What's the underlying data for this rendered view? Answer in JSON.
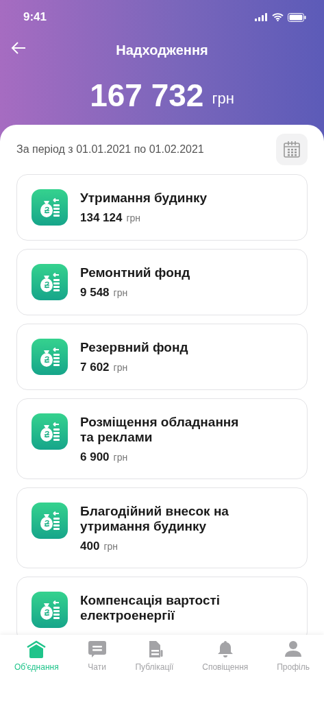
{
  "status_bar": {
    "time": "9:41"
  },
  "header": {
    "title": "Надходження",
    "total": "167 732",
    "currency": "грн"
  },
  "period": "За період з 01.01.2021 по 01.02.2021",
  "items": [
    {
      "title": "Утримання будинку",
      "amount": "134 124",
      "currency": "грн"
    },
    {
      "title": "Ремонтний фонд",
      "amount": "9 548",
      "currency": "грн"
    },
    {
      "title": "Резервний фонд",
      "amount": "7 602",
      "currency": "грн"
    },
    {
      "title": "Розміщення обладнання та реклами",
      "amount": "6 900",
      "currency": "грн"
    },
    {
      "title": "Благодійний внесок на утримання будинку",
      "amount": "400",
      "currency": "грн"
    },
    {
      "title": "Компенсація вартості електроенергії"
    }
  ],
  "tabs": [
    {
      "kind": "home",
      "label": "Об'єднання",
      "selected": true
    },
    {
      "kind": "chat",
      "label": "Чати",
      "selected": false
    },
    {
      "kind": "docs",
      "label": "Публікації",
      "selected": false
    },
    {
      "kind": "bell",
      "label": "Сповіщення",
      "selected": false
    },
    {
      "kind": "profile",
      "label": "Профіль",
      "selected": false
    }
  ]
}
